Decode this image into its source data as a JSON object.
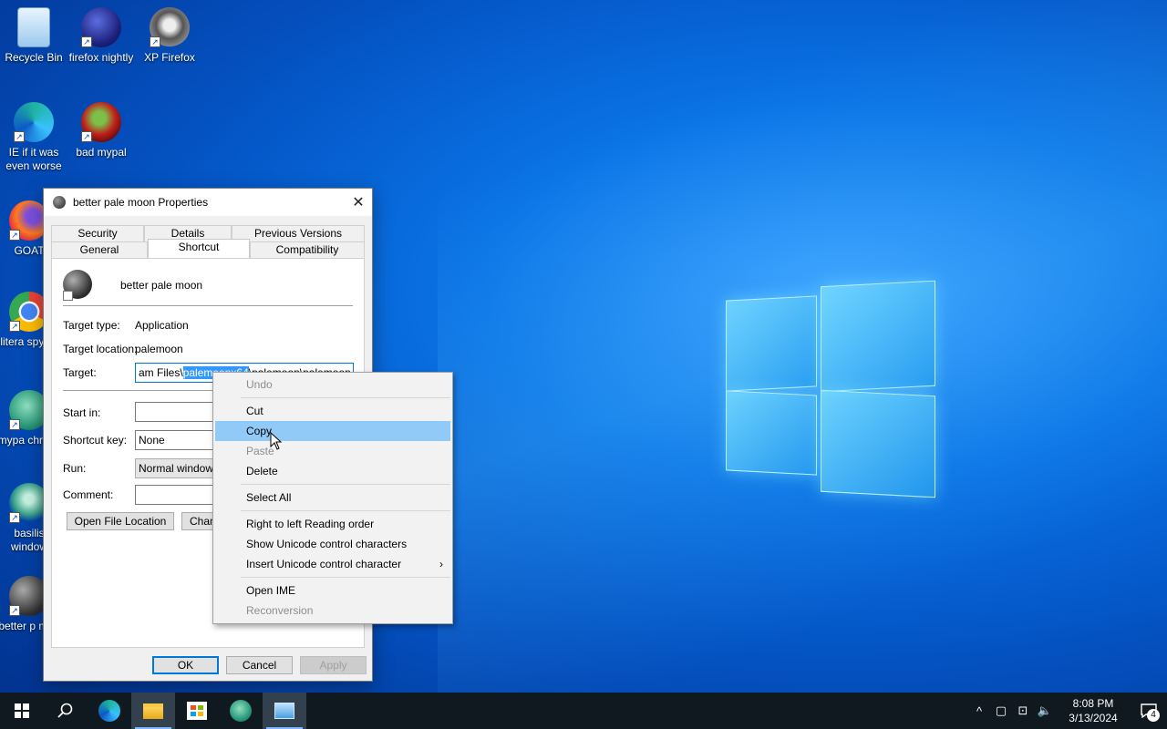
{
  "desktop": {
    "icons": [
      {
        "label": "Recycle Bin",
        "icon": "recycle-bin-icon"
      },
      {
        "label": "firefox nightly",
        "icon": "firefox-nightly-icon"
      },
      {
        "label": "XP Firefox",
        "icon": "raccoon-icon"
      },
      {
        "label": "IE if it was even worse",
        "icon": "edge-icon"
      },
      {
        "label": "bad mypal",
        "icon": "mypal-icon"
      },
      {
        "label": "GOAT",
        "icon": "firefox-icon"
      },
      {
        "label": "litera spywa",
        "icon": "chrome-icon"
      },
      {
        "label": "mypa chromi",
        "icon": "mypal-chromium-icon"
      },
      {
        "label": "basilis window",
        "icon": "basilisk-icon"
      },
      {
        "label": "better p moo",
        "icon": "pale-moon-icon"
      }
    ]
  },
  "dialog": {
    "title": "better pale moon Properties",
    "close": "✕",
    "tabs_row1": [
      "Security",
      "Details",
      "Previous Versions"
    ],
    "tabs_row2": [
      "General",
      "Shortcut",
      "Compatibility"
    ],
    "active_tab": "Shortcut",
    "shortcut_name": "better pale moon",
    "target_type_label": "Target type:",
    "target_type_value": "Application",
    "target_location_label": "Target location:",
    "target_location_value": "palemoon",
    "target_label": "Target:",
    "target_value_pre": "am Files\\",
    "target_value_selected": "palemoonx64",
    "target_value_post": "\\palemoon\\palemoon.exe\"",
    "start_in_label": "Start in:",
    "start_in_value": "",
    "shortcut_key_label": "Shortcut key:",
    "shortcut_key_value": "None",
    "run_label": "Run:",
    "run_value": "Normal window",
    "comment_label": "Comment:",
    "comment_value": "",
    "open_file_location": "Open File Location",
    "change_icon_partial": "Chan",
    "ok": "OK",
    "cancel": "Cancel",
    "apply": "Apply"
  },
  "context_menu": {
    "items": [
      {
        "label": "Undo",
        "disabled": true
      },
      {
        "sep": true
      },
      {
        "label": "Cut",
        "disabled": false
      },
      {
        "label": "Copy",
        "disabled": false,
        "hover": true
      },
      {
        "label": "Paste",
        "disabled": true
      },
      {
        "label": "Delete",
        "disabled": false
      },
      {
        "sep": true
      },
      {
        "label": "Select All",
        "disabled": false
      },
      {
        "sep": true
      },
      {
        "label": "Right to left Reading order",
        "disabled": false
      },
      {
        "label": "Show Unicode control characters",
        "disabled": false
      },
      {
        "label": "Insert Unicode control character",
        "disabled": false,
        "submenu": true
      },
      {
        "sep": true
      },
      {
        "label": "Open IME",
        "disabled": false
      },
      {
        "label": "Reconversion",
        "disabled": true
      }
    ]
  },
  "taskbar": {
    "time": "8:08 PM",
    "date": "3/13/2024",
    "notification_count": "4",
    "apps": [
      "start-icon",
      "search-icon",
      "edge-icon",
      "file-explorer-icon",
      "store-icon",
      "mypal-icon",
      "control-panel-icon"
    ]
  },
  "colors": {
    "selection": "#3399ff",
    "menu_hover": "#91c9f7",
    "taskbar": "#101820"
  }
}
